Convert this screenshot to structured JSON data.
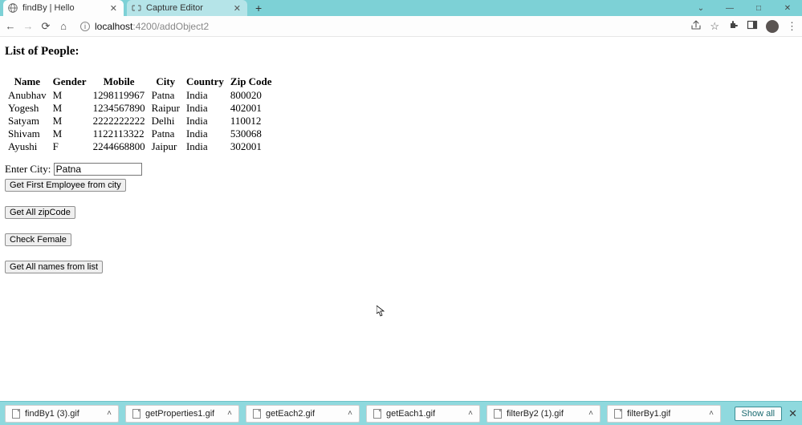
{
  "window": {
    "tabs": [
      {
        "title": "findBy | Hello",
        "active": true
      },
      {
        "title": "Capture Editor",
        "active": false
      }
    ],
    "controls": {
      "min": "—",
      "max": "□",
      "close": "✕"
    },
    "newtab": "+"
  },
  "urlbar": {
    "host": "localhost",
    "port_path": ":4200/addObject2"
  },
  "page": {
    "heading": "List of People:",
    "table": {
      "headers": [
        "Name",
        "Gender",
        "Mobile",
        "City",
        "Country",
        "Zip Code"
      ],
      "rows": [
        {
          "name": "Anubhav",
          "gender": "M",
          "mobile": "1298119967",
          "city": "Patna",
          "country": "India",
          "zip": "800020"
        },
        {
          "name": "Yogesh",
          "gender": "M",
          "mobile": "1234567890",
          "city": "Raipur",
          "country": "India",
          "zip": "402001"
        },
        {
          "name": "Satyam",
          "gender": "M",
          "mobile": "2222222222",
          "city": "Delhi",
          "country": "India",
          "zip": "110012"
        },
        {
          "name": "Shivam",
          "gender": "M",
          "mobile": "1122113322",
          "city": "Patna",
          "country": "India",
          "zip": "530068"
        },
        {
          "name": "Ayushi",
          "gender": "F",
          "mobile": "2244668800",
          "city": "Jaipur",
          "country": "India",
          "zip": "302001"
        }
      ]
    },
    "form": {
      "city_label": "Enter City:",
      "city_value": "Patna"
    },
    "buttons": {
      "get_first": "Get First Employee from city",
      "get_zip": "Get All zipCode",
      "check_female": "Check Female",
      "get_names": "Get All names from list"
    }
  },
  "downloads": {
    "items": [
      {
        "name": "findBy1 (3).gif"
      },
      {
        "name": "getProperties1.gif"
      },
      {
        "name": "getEach2.gif"
      },
      {
        "name": "getEach1.gif"
      },
      {
        "name": "filterBy2 (1).gif"
      },
      {
        "name": "filterBy1.gif"
      }
    ],
    "show_all": "Show all"
  }
}
